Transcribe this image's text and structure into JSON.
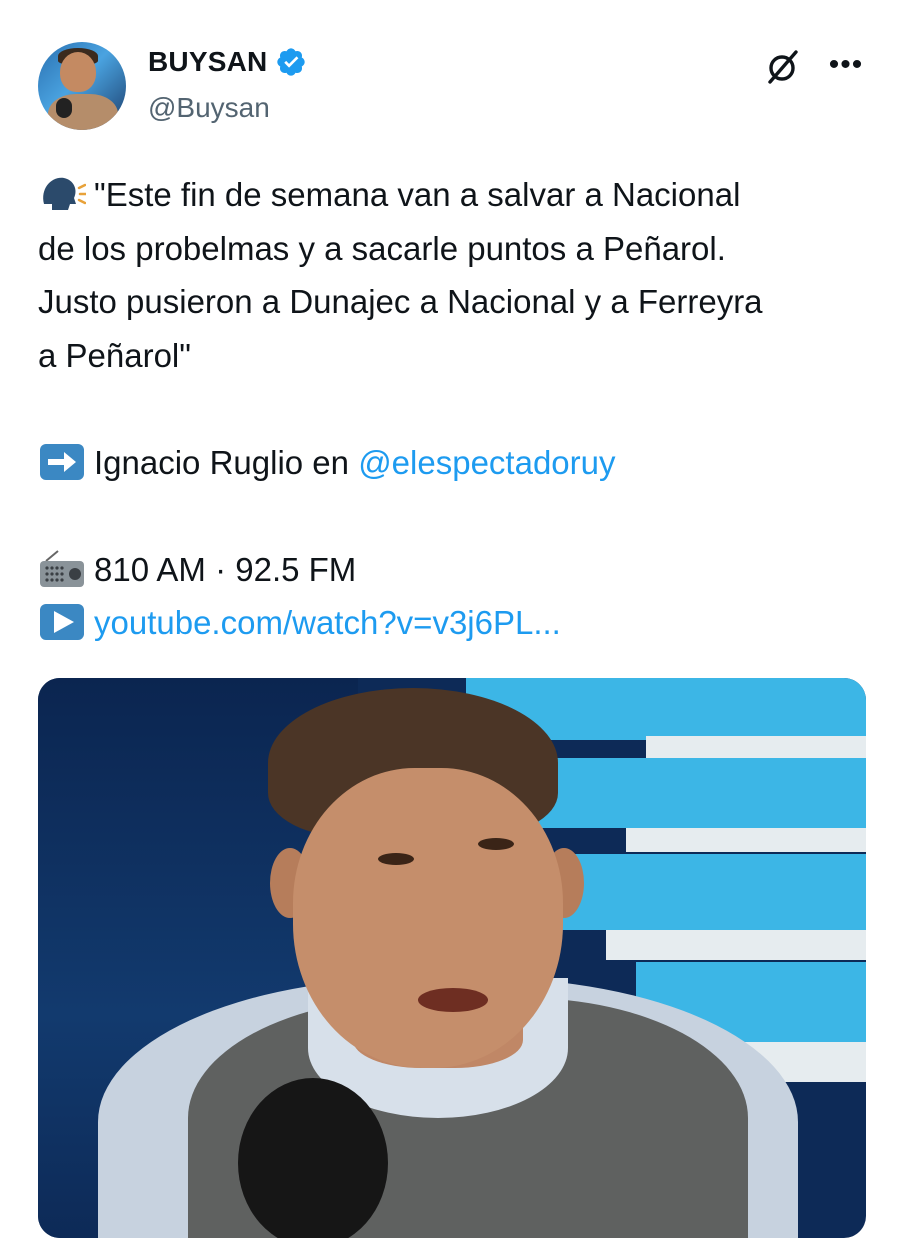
{
  "author": {
    "display_name": "BUYSAN",
    "handle": "@Buysan",
    "verified": true
  },
  "icons": {
    "avatar": "avatar-photo",
    "verified": "verified-badge-icon",
    "grok": "grok-icon",
    "more": "more-options-icon",
    "speaking_head": "speaking-head-emoji",
    "arrow_right": "right-arrow-emoji",
    "radio": "radio-emoji",
    "play": "play-button-emoji"
  },
  "tweet": {
    "line1": "\"Este fin de semana van a salvar a Nacional",
    "line2": "de los probelmas y a sacarle puntos a Peñarol.",
    "line3": "Justo pusieron a Dunajec a Nacional y a Ferreyra",
    "line4": "a Peñarol\"",
    "credit_prefix": "Ignacio Ruglio en ",
    "credit_mention": "@elespectadoruy",
    "station": "810 AM · 92.5 FM",
    "link": "youtube.com/watch?v=v3j6PL..."
  },
  "colors": {
    "text": "#0f1419",
    "secondary": "#536471",
    "link": "#1d9bf0",
    "verified": "#1d9bf0"
  }
}
